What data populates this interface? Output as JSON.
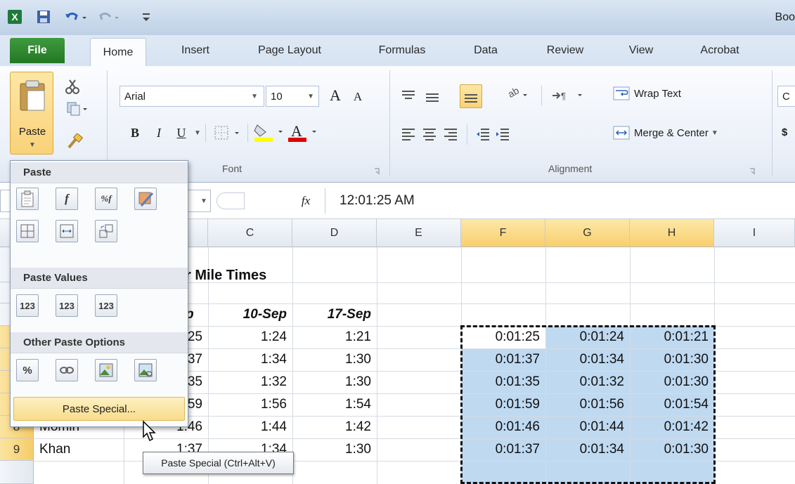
{
  "app": {
    "title": "Boo",
    "icon": "excel-icon"
  },
  "qat": {
    "save": "save-icon",
    "undo": "undo-icon",
    "redo": "redo-icon",
    "customize": "customize-icon"
  },
  "tabs": [
    "File",
    "Home",
    "Insert",
    "Page Layout",
    "Formulas",
    "Data",
    "Review",
    "View",
    "Acrobat"
  ],
  "ribbon": {
    "paste_label": "Paste",
    "font_name": "Arial",
    "font_size": "10",
    "bold": "B",
    "italic": "I",
    "underline": "U",
    "grow_font": "A",
    "shrink_font": "A",
    "font_group_label": "Font",
    "alignment_group_label": "Alignment",
    "wrap_text": "Wrap Text",
    "merge_center": "Merge & Center",
    "extra_c": "C",
    "extra_dollar": "$",
    "highlight_color": "#ffff00",
    "font_color": "#e00000"
  },
  "formula_bar": {
    "fx": "fx",
    "value": "12:01:25 AM"
  },
  "columns": [
    "C",
    "D",
    "E",
    "F",
    "G",
    "H",
    "I"
  ],
  "rows": [
    "8",
    "9"
  ],
  "sheet": {
    "title_fragment": "r Mile Times",
    "headers": [
      "p",
      "10-Sep",
      "17-Sep"
    ],
    "rows": [
      {
        "b": "25",
        "c": "1:24",
        "d": "1:21",
        "f": "0:01:25",
        "g": "0:01:24",
        "h": "0:01:21"
      },
      {
        "b": "37",
        "c": "1:34",
        "d": "1:30",
        "f": "0:01:37",
        "g": "0:01:34",
        "h": "0:01:30"
      },
      {
        "b": "35",
        "c": "1:32",
        "d": "1:30",
        "f": "0:01:35",
        "g": "0:01:32",
        "h": "0:01:30"
      },
      {
        "b": "59",
        "c": "1:56",
        "d": "1:54",
        "f": "0:01:59",
        "g": "0:01:56",
        "h": "0:01:54"
      },
      {
        "a": "Momin",
        "b": "1:46",
        "c": "1:44",
        "d": "1:42",
        "f": "0:01:46",
        "g": "0:01:44",
        "h": "0:01:42"
      },
      {
        "a": "Khan",
        "b": "1:37",
        "c": "1:34",
        "d": "1:30",
        "f": "0:01:37",
        "g": "0:01:34",
        "h": "0:01:30"
      }
    ]
  },
  "paste_menu": {
    "paste_header": "Paste",
    "values_header": "Paste Values",
    "values_icons": [
      "123",
      "123",
      "123"
    ],
    "other_header": "Other Paste Options",
    "paste_special": "Paste Special...",
    "tooltip": "Paste Special (Ctrl+Alt+V)"
  },
  "colors": {
    "file_tab": "#2f8a2f",
    "selection": "#bfd9f1",
    "header_selected": "#f8cf6c"
  }
}
